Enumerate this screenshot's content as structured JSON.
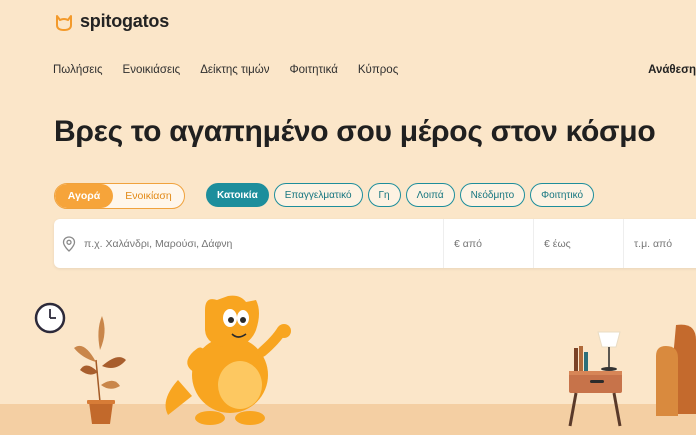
{
  "brand": {
    "name": "spitogatos"
  },
  "nav": {
    "items": [
      "Πωλήσεις",
      "Ενοικιάσεις",
      "Δείκτης τιμών",
      "Φοιτητικά",
      "Κύπρος"
    ],
    "right": "Ανάθεση"
  },
  "hero": {
    "title": "Βρες το αγαπημένο σου μέρος στον κόσμο"
  },
  "toggle": {
    "buy": "Αγορά",
    "rent": "Ενοικίαση",
    "selected": "Αγορά"
  },
  "chips": [
    "Κατοικία",
    "Επαγγελματικό",
    "Γη",
    "Λοιπά",
    "Νεόδμητο",
    "Φοιτητικό"
  ],
  "chips_selected": "Κατοικία",
  "search": {
    "location_placeholder": "π.χ. Χαλάνδρι, Μαρούσι, Δάφνη",
    "price_from_placeholder": "€ από",
    "price_to_placeholder": "€ έως",
    "area_from_placeholder": "τ.μ. από"
  },
  "colors": {
    "background": "#fbe6c9",
    "accent_orange": "#f6a43a",
    "accent_teal": "#1d8e9c"
  },
  "icons": [
    "cat-logo-icon",
    "location-pin-icon",
    "clock-icon"
  ]
}
